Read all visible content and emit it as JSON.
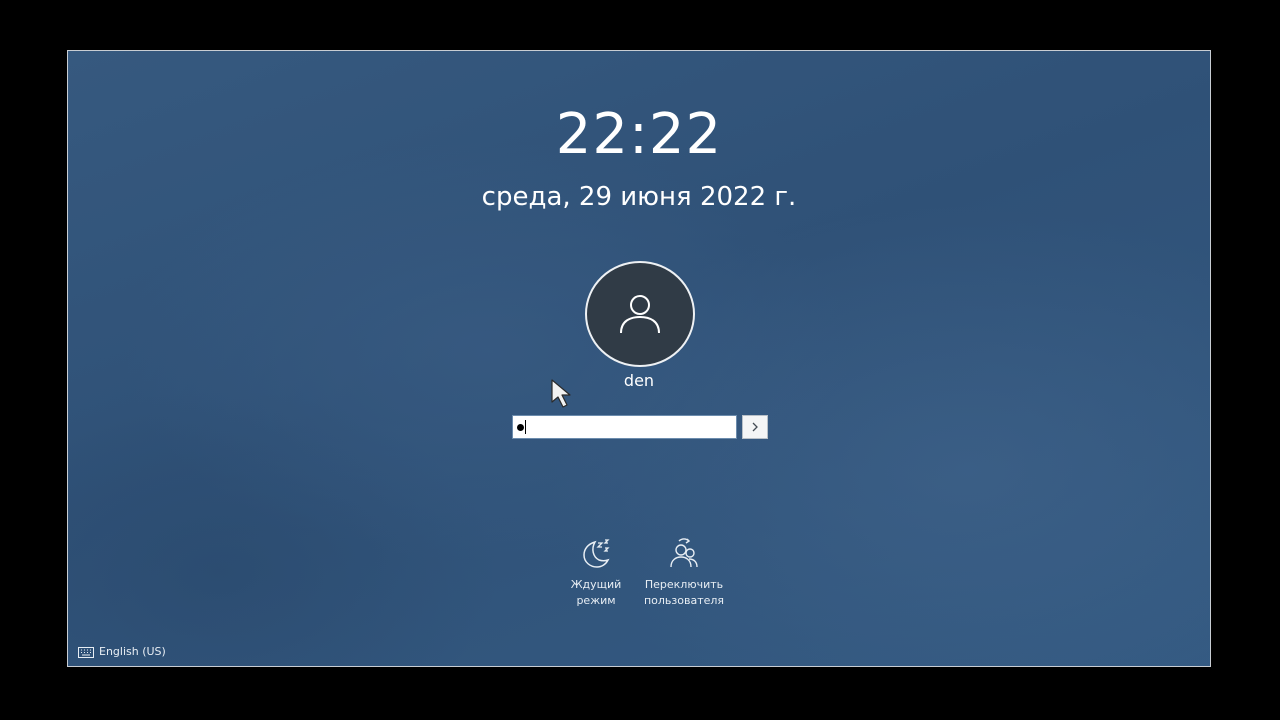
{
  "lockscreen": {
    "time": "22:22",
    "date": "среда, 29 июня 2022 г.",
    "user": {
      "name": "den",
      "avatar_icon": "user-icon"
    },
    "password": {
      "masked_chars": 1,
      "submit_icon": "chevron-right-icon"
    },
    "actions": [
      {
        "label": "Ждущий\nрежим",
        "icon": "sleep-moon-icon"
      },
      {
        "label": "Переключить\nпользователя",
        "icon": "switch-user-icon"
      }
    ],
    "keyboard_layout": {
      "label": "English (US)",
      "icon": "keyboard-icon"
    }
  },
  "colors": {
    "background": "#2f5177",
    "text": "#ffffff",
    "avatar_bg": "#303b46"
  }
}
